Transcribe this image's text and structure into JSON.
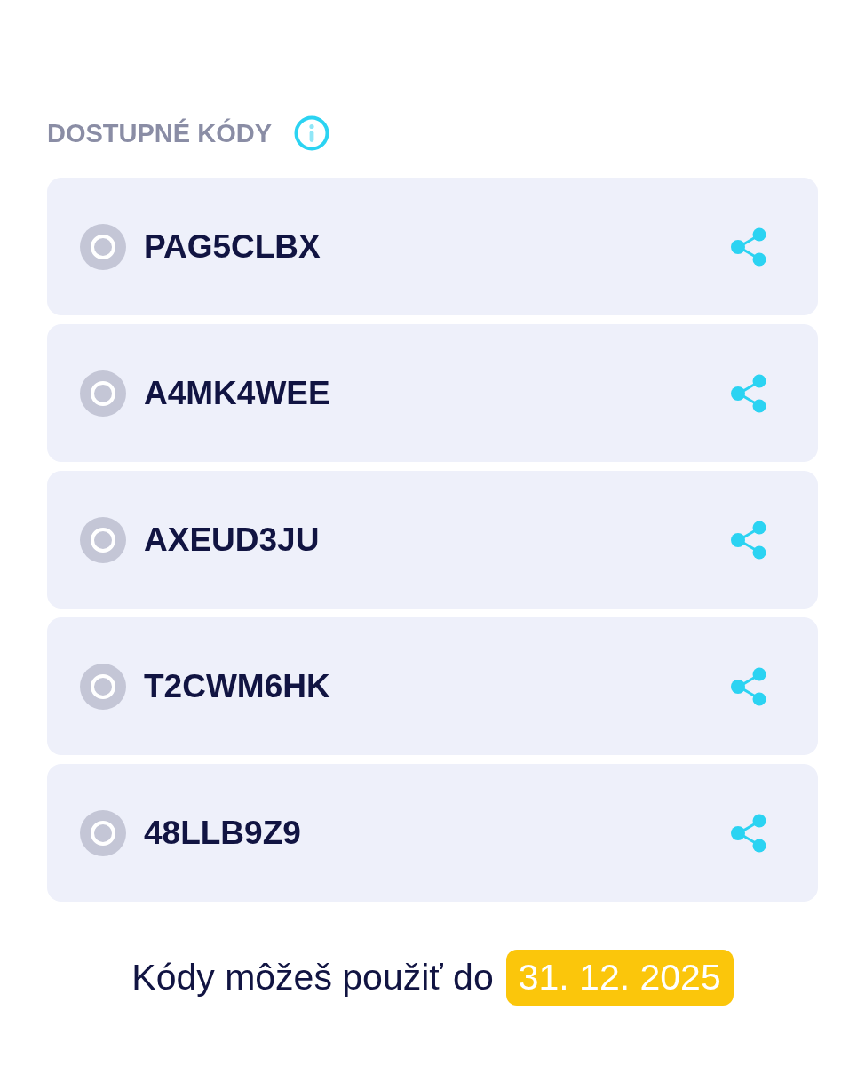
{
  "header": {
    "title": "DOSTUPNÉ KÓDY"
  },
  "codes": [
    {
      "code": "PAG5CLBX",
      "selected": false
    },
    {
      "code": "A4MK4WEE",
      "selected": false
    },
    {
      "code": "AXEUD3JU",
      "selected": false
    },
    {
      "code": "T2CWM6HK",
      "selected": false
    },
    {
      "code": "48LLB9Z9",
      "selected": false
    }
  ],
  "footer": {
    "text": "Kódy môžeš použiť do",
    "date": "31. 12. 2025"
  }
}
